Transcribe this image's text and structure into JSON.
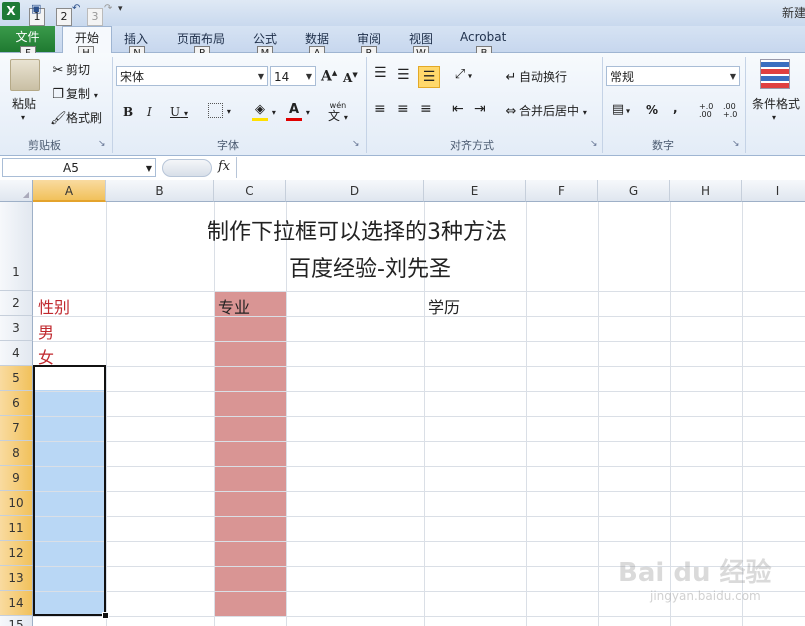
{
  "titlebar": {
    "app_icon": "excel-icon",
    "qat_keys": [
      "1",
      "2",
      "3"
    ],
    "title": "新建"
  },
  "tabs": {
    "file": "文件",
    "file_key": "F",
    "home": "开始",
    "home_key": "H",
    "items": [
      {
        "label": "插入",
        "key": "N"
      },
      {
        "label": "页面布局",
        "key": "P"
      },
      {
        "label": "公式",
        "key": "M"
      },
      {
        "label": "数据",
        "key": "A"
      },
      {
        "label": "审阅",
        "key": "R"
      },
      {
        "label": "视图",
        "key": "W"
      },
      {
        "label": "Acrobat",
        "key": "B"
      }
    ]
  },
  "ribbon": {
    "clipboard": {
      "paste": "粘贴",
      "cut": "剪切",
      "copy": "复制",
      "format_painter": "格式刷",
      "label": "剪贴板"
    },
    "font": {
      "name": "宋体",
      "size": "14",
      "grow": "A",
      "shrink": "A",
      "bold": "B",
      "italic": "I",
      "underline": "U",
      "wen": "wén",
      "wen_char": "文",
      "label": "字体"
    },
    "alignment": {
      "wrap": "自动换行",
      "merge": "合并后居中",
      "label": "对齐方式"
    },
    "number": {
      "format": "常规",
      "percent": "%",
      "comma": ",",
      "inc": "+.0 .00",
      "dec": ".00 +.0",
      "label": "数字"
    },
    "styles": {
      "conditional": "条件格式"
    }
  },
  "formula_bar": {
    "name_box": "A5",
    "fx": "fx",
    "value": ""
  },
  "sheet": {
    "columns": [
      "A",
      "B",
      "C",
      "D",
      "E",
      "F",
      "G",
      "H",
      "I"
    ],
    "rows": [
      "1",
      "2",
      "3",
      "4",
      "5",
      "6",
      "7",
      "8",
      "9",
      "10",
      "11",
      "12",
      "13",
      "14",
      "15"
    ],
    "title_line1": "制作下拉框可以选择的3种方法",
    "title_line2": "百度经验-刘先圣",
    "a2": "性别",
    "a3": "男",
    "a4": "女",
    "c2": "专业",
    "e2": "学历"
  },
  "colors": {
    "red_text": "#c0282e",
    "highlight_blue": "#b9d7f5",
    "highlight_red": "#d99594"
  },
  "watermark": {
    "brand": "Bai du 经验",
    "url": "jingyan.baidu.com"
  }
}
